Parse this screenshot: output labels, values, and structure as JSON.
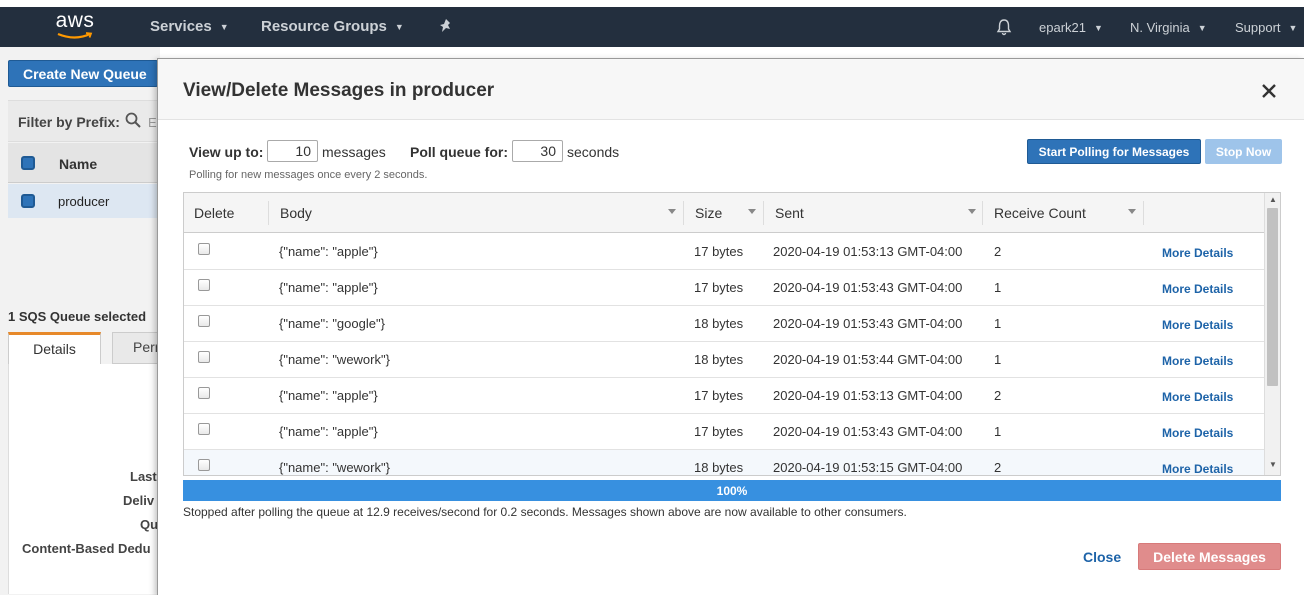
{
  "topnav": {
    "logo": "aws",
    "services": "Services",
    "resource_groups": "Resource Groups",
    "user": "epark21",
    "region": "N. Virginia",
    "support": "Support",
    "icons": [
      "bell-icon",
      "pin-icon",
      "chevron-down-icon"
    ]
  },
  "background": {
    "create_queue_label": "Create New Queue",
    "filter_label": "Filter by Prefix:",
    "filter_placeholder_visible": "E",
    "list_header": "Name",
    "queue_name": "producer",
    "selected_count": "1 SQS Queue selected",
    "tabs": [
      "Details",
      "Perm"
    ],
    "detail_labels": [
      "Last",
      "Deliv",
      "Qu",
      "Content-Based Dedu"
    ]
  },
  "modal": {
    "title": "View/Delete Messages in producer",
    "view_up_to_label": "View up to:",
    "view_up_to_value": "10",
    "messages_label": "messages",
    "poll_label": "Poll queue for:",
    "poll_value": "30",
    "seconds_label": "seconds",
    "poll_note": "Polling for new messages once every 2 seconds.",
    "start_polling_label": "Start Polling for Messages",
    "stop_now_label": "Stop Now",
    "columns": {
      "delete": "Delete",
      "body": "Body",
      "size": "Size",
      "sent": "Sent",
      "receive_count": "Receive Count"
    },
    "more_details_label": "More Details",
    "rows": [
      {
        "body": "{\"name\": \"apple\"}",
        "size": "17 bytes",
        "sent": "2020-04-19 01:53:13 GMT-04:00",
        "receive_count": "2"
      },
      {
        "body": "{\"name\": \"apple\"}",
        "size": "17 bytes",
        "sent": "2020-04-19 01:53:43 GMT-04:00",
        "receive_count": "1"
      },
      {
        "body": "{\"name\": \"google\"}",
        "size": "18 bytes",
        "sent": "2020-04-19 01:53:43 GMT-04:00",
        "receive_count": "1"
      },
      {
        "body": "{\"name\": \"wework\"}",
        "size": "18 bytes",
        "sent": "2020-04-19 01:53:44 GMT-04:00",
        "receive_count": "1"
      },
      {
        "body": "{\"name\": \"apple\"}",
        "size": "17 bytes",
        "sent": "2020-04-19 01:53:13 GMT-04:00",
        "receive_count": "2"
      },
      {
        "body": "{\"name\": \"apple\"}",
        "size": "17 bytes",
        "sent": "2020-04-19 01:53:43 GMT-04:00",
        "receive_count": "1"
      },
      {
        "body": "{\"name\": \"wework\"}",
        "size": "18 bytes",
        "sent": "2020-04-19 01:53:15 GMT-04:00",
        "receive_count": "2"
      }
    ],
    "progress_fraction": 1.0,
    "progress_label": "100%",
    "status_message": "Stopped after polling the queue at 12.9 receives/second for 0.2 seconds. Messages shown above are now available to other consumers.",
    "close_label": "Close",
    "delete_messages_label": "Delete Messages"
  },
  "colors": {
    "nav_bg": "#232f3e",
    "primary_blue": "#2e73b8",
    "link_blue": "#1d63a8",
    "progress_blue": "#3790e0",
    "delete_red_disabled": "#e08c8c",
    "tab_accent": "#e7892a"
  }
}
